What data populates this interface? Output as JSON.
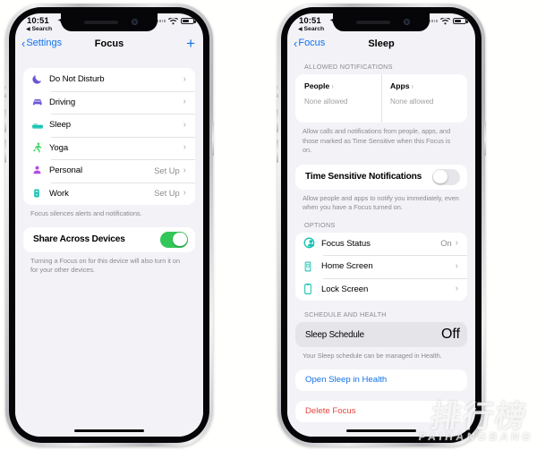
{
  "status_bar": {
    "time": "10:51",
    "location_icon": "location-arrow-icon",
    "back_to_search": "Search",
    "wifi_icon": "wifi-icon",
    "battery_icon": "battery-icon"
  },
  "colors": {
    "accent_blue": "#1272ec",
    "destructive_red": "#e8453c",
    "toggle_on_green": "#33c759",
    "screen_bg": "#f2f2f7",
    "purple": "#6a57d6",
    "teal": "#19c3b2",
    "green": "#30d158"
  },
  "left_phone": {
    "nav": {
      "back_label": "Settings",
      "title": "Focus",
      "add_label": "+"
    },
    "focus_list": [
      {
        "icon": "moon-icon",
        "label": "Do Not Disturb",
        "value": "",
        "chevron": "›"
      },
      {
        "icon": "car-icon",
        "label": "Driving",
        "value": "",
        "chevron": "›"
      },
      {
        "icon": "bed-icon",
        "label": "Sleep",
        "value": "",
        "chevron": "›"
      },
      {
        "icon": "person-run-icon",
        "label": "Yoga",
        "value": "",
        "chevron": "›"
      },
      {
        "icon": "person-icon",
        "label": "Personal",
        "value": "Set Up",
        "chevron": "›"
      },
      {
        "icon": "briefcase-icon",
        "label": "Work",
        "value": "Set Up",
        "chevron": "›"
      }
    ],
    "list_footnote": "Focus silences alerts and notifications.",
    "share_row": {
      "label": "Share Across Devices",
      "toggle_state": "on"
    },
    "share_footnote": "Turning a Focus on for this device will also turn it on for your other devices."
  },
  "right_phone": {
    "nav": {
      "back_label": "Focus",
      "title": "Sleep"
    },
    "allowed_header": "ALLOWED NOTIFICATIONS",
    "allowed_cells": [
      {
        "title": "People",
        "subtitle": "None allowed",
        "chevron": "›"
      },
      {
        "title": "Apps",
        "subtitle": "None allowed",
        "chevron": "›"
      }
    ],
    "allowed_footnote": "Allow calls and notifications from people, apps, and those marked as Time Sensitive when this Focus is on.",
    "time_sensitive_row": {
      "label": "Time Sensitive Notifications",
      "toggle_state": "off"
    },
    "time_sensitive_footnote": "Allow people and apps to notify you immediately, even when you have a Focus turned on.",
    "options_header": "OPTIONS",
    "options_list": [
      {
        "icon": "focus-status-icon",
        "label": "Focus Status",
        "value": "On",
        "chevron": "›"
      },
      {
        "icon": "home-screen-icon",
        "label": "Home Screen",
        "value": "",
        "chevron": "›"
      },
      {
        "icon": "lock-screen-icon",
        "label": "Lock Screen",
        "value": "",
        "chevron": "›"
      }
    ],
    "schedule_header": "SCHEDULE AND HEALTH",
    "schedule_row": {
      "label": "Sleep Schedule",
      "value": "Off"
    },
    "schedule_footnote": "Your Sleep schedule can be managed in Health.",
    "open_health_label": "Open Sleep in Health",
    "delete_label": "Delete Focus"
  },
  "watermark": {
    "cn": "排行榜",
    "en": "PAIHANGBANG"
  }
}
